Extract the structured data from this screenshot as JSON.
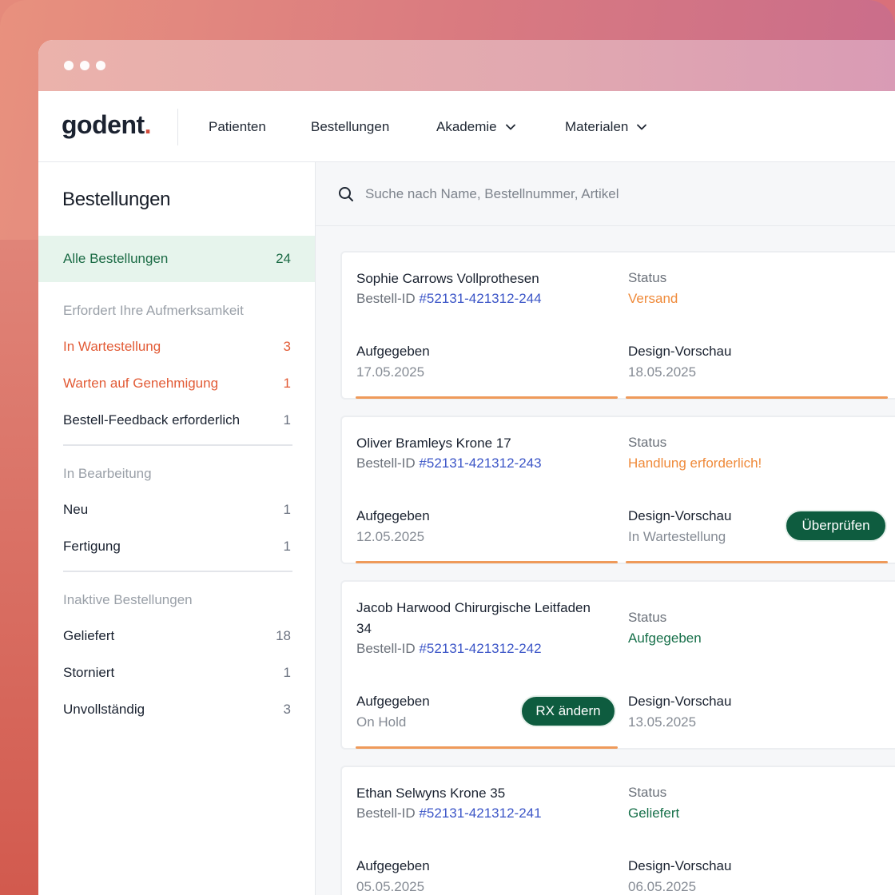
{
  "nav": {
    "logo": "godent",
    "logo_dot": ".",
    "items": [
      {
        "label": "Patienten"
      },
      {
        "label": "Bestellungen"
      },
      {
        "label": "Akademie"
      },
      {
        "label": "Materialen"
      }
    ]
  },
  "sidebar": {
    "title": "Bestellungen",
    "all": {
      "label": "Alle Bestellungen",
      "count": "24"
    },
    "sections": [
      {
        "heading": "Erfordert Ihre Aufmerksamkeit",
        "items": [
          {
            "label": "In Wartestellung",
            "count": "3"
          },
          {
            "label": "Warten auf Genehmigung",
            "count": "1"
          },
          {
            "label": "Bestell-Feedback erforderlich",
            "count": "1"
          }
        ]
      },
      {
        "heading": "In Bearbeitung",
        "items": [
          {
            "label": "Neu",
            "count": "1"
          },
          {
            "label": "Fertigung",
            "count": "1"
          }
        ]
      },
      {
        "heading": "Inaktive Bestellungen",
        "items": [
          {
            "label": "Geliefert",
            "count": "18"
          },
          {
            "label": "Storniert",
            "count": "1"
          },
          {
            "label": "Unvollständig",
            "count": "3"
          }
        ]
      }
    ]
  },
  "search": {
    "placeholder": "Suche nach Name, Bestellnummer, Artikel"
  },
  "orders": [
    {
      "title": "Sophie Carrows Vollprothesen",
      "id_label": "Bestell-ID",
      "id": "#52131-421312-244",
      "status_label": "Status",
      "status": "Versand",
      "placed_label": "Aufgegeben",
      "placed": "17.05.2025",
      "preview_label": "Design-Vorschau",
      "preview": "18.05.2025"
    },
    {
      "title": "Oliver Bramleys Krone 17",
      "id_label": "Bestell-ID",
      "id": "#52131-421312-243",
      "status_label": "Status",
      "status": "Handlung erforderlich!",
      "placed_label": "Aufgegeben",
      "placed": "12.05.2025",
      "preview_label": "Design-Vorschau",
      "preview": "In Wartestellung",
      "action": "Überprüfen"
    },
    {
      "title": "Jacob Harwood Chirurgische Leitfaden 34",
      "id_label": "Bestell-ID",
      "id": "#52131-421312-242",
      "status_label": "Status",
      "status": "Aufgegeben",
      "placed_label": "Aufgegeben",
      "placed": "On Hold",
      "preview_label": "Design-Vorschau",
      "preview": "13.05.2025",
      "action": "RX ändern"
    },
    {
      "title": "Ethan Selwyns Krone 35",
      "id_label": "Bestell-ID",
      "id": "#52131-421312-241",
      "status_label": "Status",
      "status": "Geliefert",
      "placed_label": "Aufgegeben",
      "placed": "05.05.2025",
      "preview_label": "Design-Vorschau",
      "preview": "06.05.2025"
    }
  ],
  "colors": {
    "accent_green": "#0e5c3f",
    "warning_orange": "#ef8a3a",
    "alert_red": "#e25b36",
    "link_blue": "#3b55c7"
  }
}
